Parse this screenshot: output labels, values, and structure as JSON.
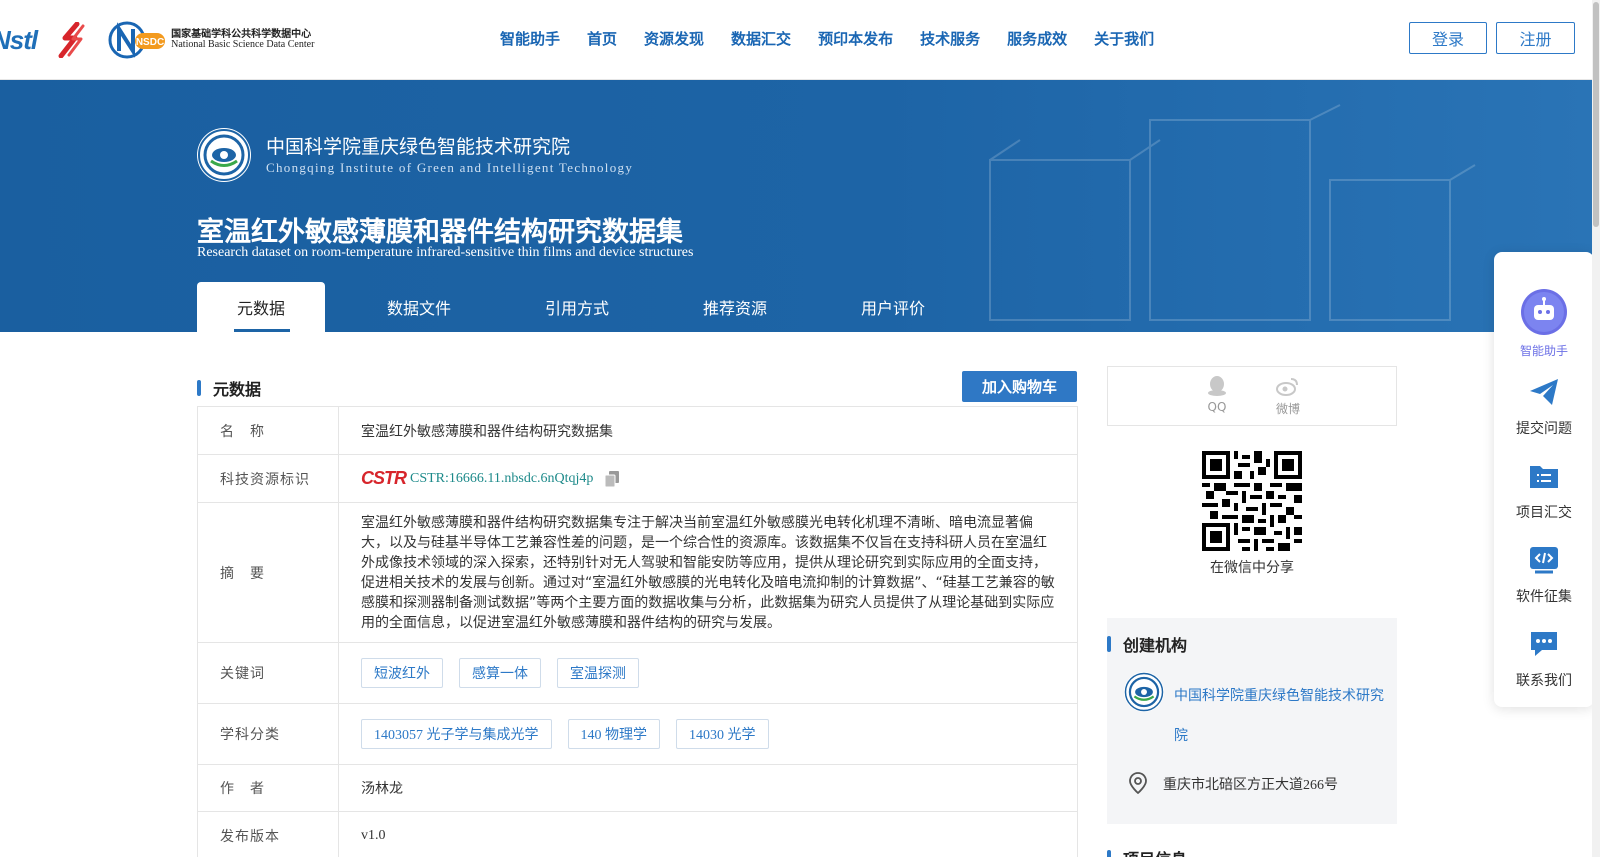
{
  "header": {
    "logos": {
      "nstl": "Nstl",
      "nsdc_mark": "NSDC",
      "nsdc_cn": "国家基础学科公共科学数据中心",
      "nsdc_en": "National Basic Science Data Center"
    },
    "nav": [
      "智能助手",
      "首页",
      "资源发现",
      "数据汇交",
      "预印本发布",
      "技术服务",
      "服务成效",
      "关于我们"
    ],
    "login_label": "登录",
    "register_label": "注册"
  },
  "banner": {
    "institution_cn": "中国科学院重庆绿色智能技术研究院",
    "institution_en": "Chongqing Institute of Green and Intelligent Technology",
    "title": "室温红外敏感薄膜和器件结构研究数据集",
    "subtitle": "Research dataset on room-temperature infrared-sensitive thin films and device structures",
    "tabs": [
      "元数据",
      "数据文件",
      "引用方式",
      "推荐资源",
      "用户评价"
    ],
    "active_tab": 0
  },
  "metadata": {
    "section_title": "元数据",
    "cart_button": "加入购物车",
    "rows": {
      "name_label": "名　称",
      "name_value": "室温红外敏感薄膜和器件结构研究数据集",
      "id_label": "科技资源标识",
      "id_logo": "CSTR",
      "id_value": "CSTR:16666.11.nbsdc.6nQtqj4p",
      "abstract_label": "摘　要",
      "abstract_value": "室温红外敏感薄膜和器件结构研究数据集专注于解决当前室温红外敏感膜光电转化机理不清晰、暗电流显著偏大，以及与硅基半导体工艺兼容性差的问题，是一个综合性的资源库。该数据集不仅旨在支持科研人员在室温红外成像技术领域的深入探索，还特别针对无人驾驶和智能安防等应用，提供从理论研究到实际应用的全面支持，促进相关技术的发展与创新。通过对“室温红外敏感膜的光电转化及暗电流抑制的计算数据”、“硅基工艺兼容的敏感膜和探测器制备测试数据”等两个主要方面的数据收集与分析，此数据集为研究人员提供了从理论基础到实际应用的全面信息，以促进室温红外敏感薄膜和器件结构的研究与发展。",
      "keywords_label": "关键词",
      "keywords": [
        "短波红外",
        "感算一体",
        "室温探测"
      ],
      "subject_label": "学科分类",
      "subjects": [
        "1403057 光子学与集成光学",
        "140 物理学",
        "14030 光学"
      ],
      "author_label": "作　者",
      "author_value": "汤林龙",
      "version_label": "发布版本",
      "version_value": "v1.0"
    }
  },
  "share": {
    "qq": "QQ",
    "weibo": "微博",
    "wechat_caption": "在微信中分享"
  },
  "organization": {
    "section_title": "创建机构",
    "name": "中国科学院重庆绿色智能技术研究院",
    "address": "重庆市北碚区方正大道266号"
  },
  "project": {
    "section_title": "项目信息"
  },
  "side_panel": {
    "items": [
      "智能助手",
      "提交问题",
      "项目汇交",
      "软件征集",
      "联系我们"
    ]
  },
  "colors": {
    "brand_blue": "#1d64a6",
    "nav_blue": "#1a66b3",
    "button_blue": "#2f78c5",
    "cstr_red": "#d7252b"
  }
}
